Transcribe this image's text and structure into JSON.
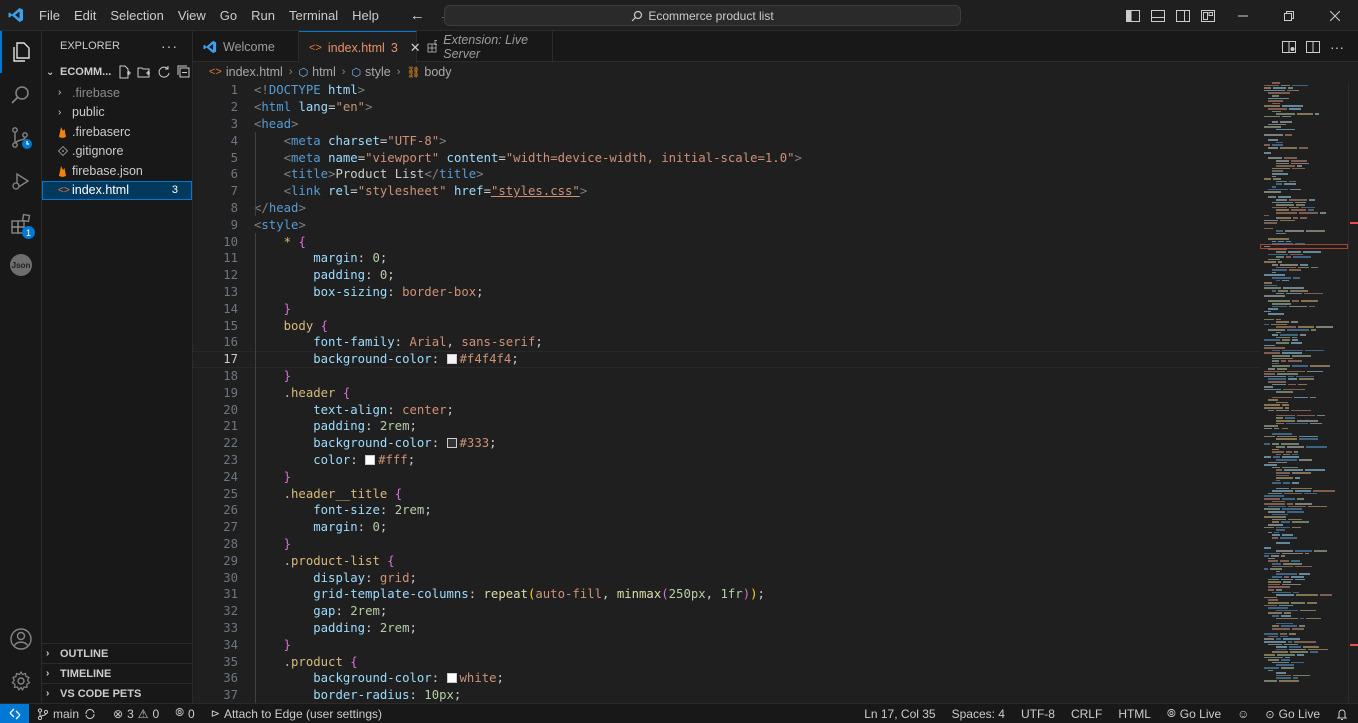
{
  "menu": [
    "File",
    "Edit",
    "Selection",
    "View",
    "Go",
    "Run",
    "Terminal",
    "Help"
  ],
  "command_center": {
    "label": "Ecommerce product list"
  },
  "sidebar": {
    "title": "EXPLORER",
    "folder": "ECOMM...",
    "items": [
      {
        "label": ".firebase",
        "type": "folder",
        "dim": true
      },
      {
        "label": "public",
        "type": "folder",
        "dim": false
      },
      {
        "label": ".firebaserc",
        "type": "firebase",
        "dim": false
      },
      {
        "label": ".gitignore",
        "type": "git",
        "dim": false
      },
      {
        "label": "firebase.json",
        "type": "firebase",
        "dim": false
      },
      {
        "label": "index.html",
        "type": "html",
        "dim": false,
        "count": "3",
        "selected": true
      }
    ],
    "sections": [
      "OUTLINE",
      "TIMELINE",
      "VS CODE PETS"
    ]
  },
  "activity": {
    "extensions_badge": "1",
    "json_label": "Json"
  },
  "tabs": [
    {
      "label": "Welcome",
      "icon": "vscode-icon"
    },
    {
      "label": "index.html",
      "count": "3",
      "icon": "html-icon",
      "active": true
    },
    {
      "label": "Extension: Live Server",
      "icon": "extension-icon",
      "italic": true
    }
  ],
  "breadcrumb": [
    "index.html",
    "html",
    "style",
    "body"
  ],
  "editor": {
    "current_line": 17,
    "lines": [
      "<!DOCTYPE html>",
      "<html lang=\"en\">",
      "<head>",
      "    <meta charset=\"UTF-8\">",
      "    <meta name=\"viewport\" content=\"width=device-width, initial-scale=1.0\">",
      "    <title>Product List</title>",
      "    <link rel=\"stylesheet\" href=\"styles.css\">",
      "</head>",
      "<style>",
      "    * {",
      "        margin: 0;",
      "        padding: 0;",
      "        box-sizing: border-box;",
      "    }",
      "    body {",
      "        font-family: Arial, sans-serif;",
      "        background-color: #f4f4f4;",
      "    }",
      "    .header {",
      "        text-align: center;",
      "        padding: 2rem;",
      "        background-color: #333;",
      "        color: #fff;",
      "    }",
      "    .header__title {",
      "        font-size: 2rem;",
      "        margin: 0;",
      "    }",
      "    .product-list {",
      "        display: grid;",
      "        grid-template-columns: repeat(auto-fill, minmax(250px, 1fr));",
      "        gap: 2rem;",
      "        padding: 2rem;",
      "    }",
      "    .product {",
      "        background-color: white;",
      "        border-radius: 10px;"
    ]
  },
  "status": {
    "branch": "main",
    "errors": "3",
    "warnings": "0",
    "ports": "0",
    "attach": "Attach to Edge (user settings)",
    "position": "Ln 17, Col 35",
    "spaces": "Spaces: 4",
    "encoding": "UTF-8",
    "eol": "CRLF",
    "language": "HTML",
    "go_live_1": "Go Live",
    "go_live_2": "Go Live"
  },
  "colors": {
    "accent": "#0078d4",
    "html_icon": "#e37933",
    "firebase_icon": "#f5820d"
  }
}
